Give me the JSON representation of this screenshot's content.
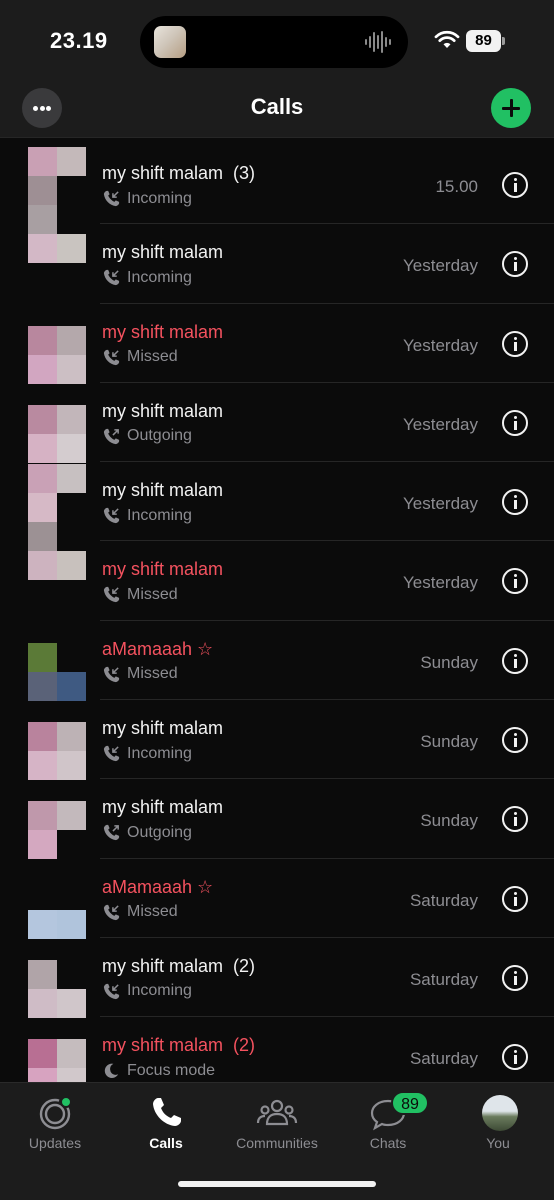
{
  "status_bar": {
    "time": "23.19",
    "battery": "89"
  },
  "header": {
    "title": "Calls"
  },
  "calls": [
    {
      "name": "my shift malam",
      "count": "(3)",
      "type": "Incoming",
      "direction": "in",
      "missed": false,
      "time": "15.00",
      "avatar": [
        "#c9a0b4",
        "#c4b9ba",
        "#9e8f94",
        "",
        "#a89fa2",
        "",
        "#d3b8c6",
        "#c9c4c0"
      ]
    },
    {
      "name": "my shift malam",
      "count": "",
      "type": "Incoming",
      "direction": "in",
      "missed": false,
      "time": "Yesterday",
      "avatar": [
        "",
        "",
        "",
        "",
        "",
        "",
        "",
        ""
      ]
    },
    {
      "name": "my shift malam",
      "count": "",
      "type": "Missed",
      "direction": "in",
      "missed": true,
      "time": "Yesterday",
      "avatar": [
        "#b8879e",
        "#b4a8ab",
        "#d2a6c1",
        "#ccbfc4"
      ]
    },
    {
      "name": "my shift malam",
      "count": "",
      "type": "Outgoing",
      "direction": "out",
      "missed": false,
      "time": "Yesterday",
      "avatar": [
        "#b98aa0",
        "#c2b6ba",
        "#d6b2c4",
        "#d4cccf"
      ]
    },
    {
      "name": "my shift malam",
      "count": "",
      "type": "Incoming",
      "direction": "in",
      "missed": false,
      "time": "Yesterday",
      "avatar": [
        "#c9a1b6",
        "#c7c0c1",
        "#d6b9c6",
        "",
        "#9c9194",
        "",
        "#cdb3bf",
        "#c8c1bd"
      ]
    },
    {
      "name": "my shift malam",
      "count": "",
      "type": "Missed",
      "direction": "in",
      "missed": true,
      "time": "Yesterday",
      "avatar": [
        "",
        "",
        "",
        "",
        "",
        "",
        "",
        ""
      ]
    },
    {
      "name": "aMamaaah ☆",
      "count": "",
      "type": "Missed",
      "direction": "in",
      "missed": true,
      "time": "Sunday",
      "avatar": [
        "#5b7a37",
        "",
        "#5a6278",
        "#3f5a82"
      ]
    },
    {
      "name": "my shift malam",
      "count": "",
      "type": "Incoming",
      "direction": "in",
      "missed": false,
      "time": "Sunday",
      "avatar": [
        "#b9839d",
        "#bdb2b5",
        "#d6b4c6",
        "#d0c5c9"
      ]
    },
    {
      "name": "my shift malam",
      "count": "",
      "type": "Outgoing",
      "direction": "out",
      "missed": false,
      "time": "Sunday",
      "avatar": [
        "#bf98ab",
        "#c3b9bc",
        "#d4a8c0",
        ""
      ]
    },
    {
      "name": "aMamaaah ☆",
      "count": "",
      "type": "Missed",
      "direction": "in",
      "missed": true,
      "time": "Saturday",
      "avatar": [
        "",
        "",
        "#b4c6de",
        "#b0c4dc"
      ]
    },
    {
      "name": "my shift malam",
      "count": "(2)",
      "type": "Incoming",
      "direction": "in",
      "missed": false,
      "time": "Saturday",
      "avatar": [
        "#b0a4a8",
        "",
        "#cfbcc6",
        "#d0c6ca"
      ]
    },
    {
      "name": "my shift malam",
      "count": "(2)",
      "type": "Focus mode",
      "direction": "focus",
      "missed": true,
      "time": "Saturday",
      "avatar": [
        "#b86f93",
        "#c5bcbe",
        "#d7a3c0",
        "#d1c8cb"
      ]
    }
  ],
  "tabs": [
    {
      "label": "Updates",
      "icon": "updates-icon",
      "active": false
    },
    {
      "label": "Calls",
      "icon": "phone-icon",
      "active": true
    },
    {
      "label": "Communities",
      "icon": "communities-icon",
      "active": false
    },
    {
      "label": "Chats",
      "icon": "chats-icon",
      "active": false,
      "badge": "89"
    },
    {
      "label": "You",
      "icon": "profile-avatar",
      "active": false
    }
  ],
  "colors": {
    "accent": "#21c063",
    "missed": "#f4525f",
    "secondary": "#8d8d92",
    "background": "#0b0b0b"
  }
}
